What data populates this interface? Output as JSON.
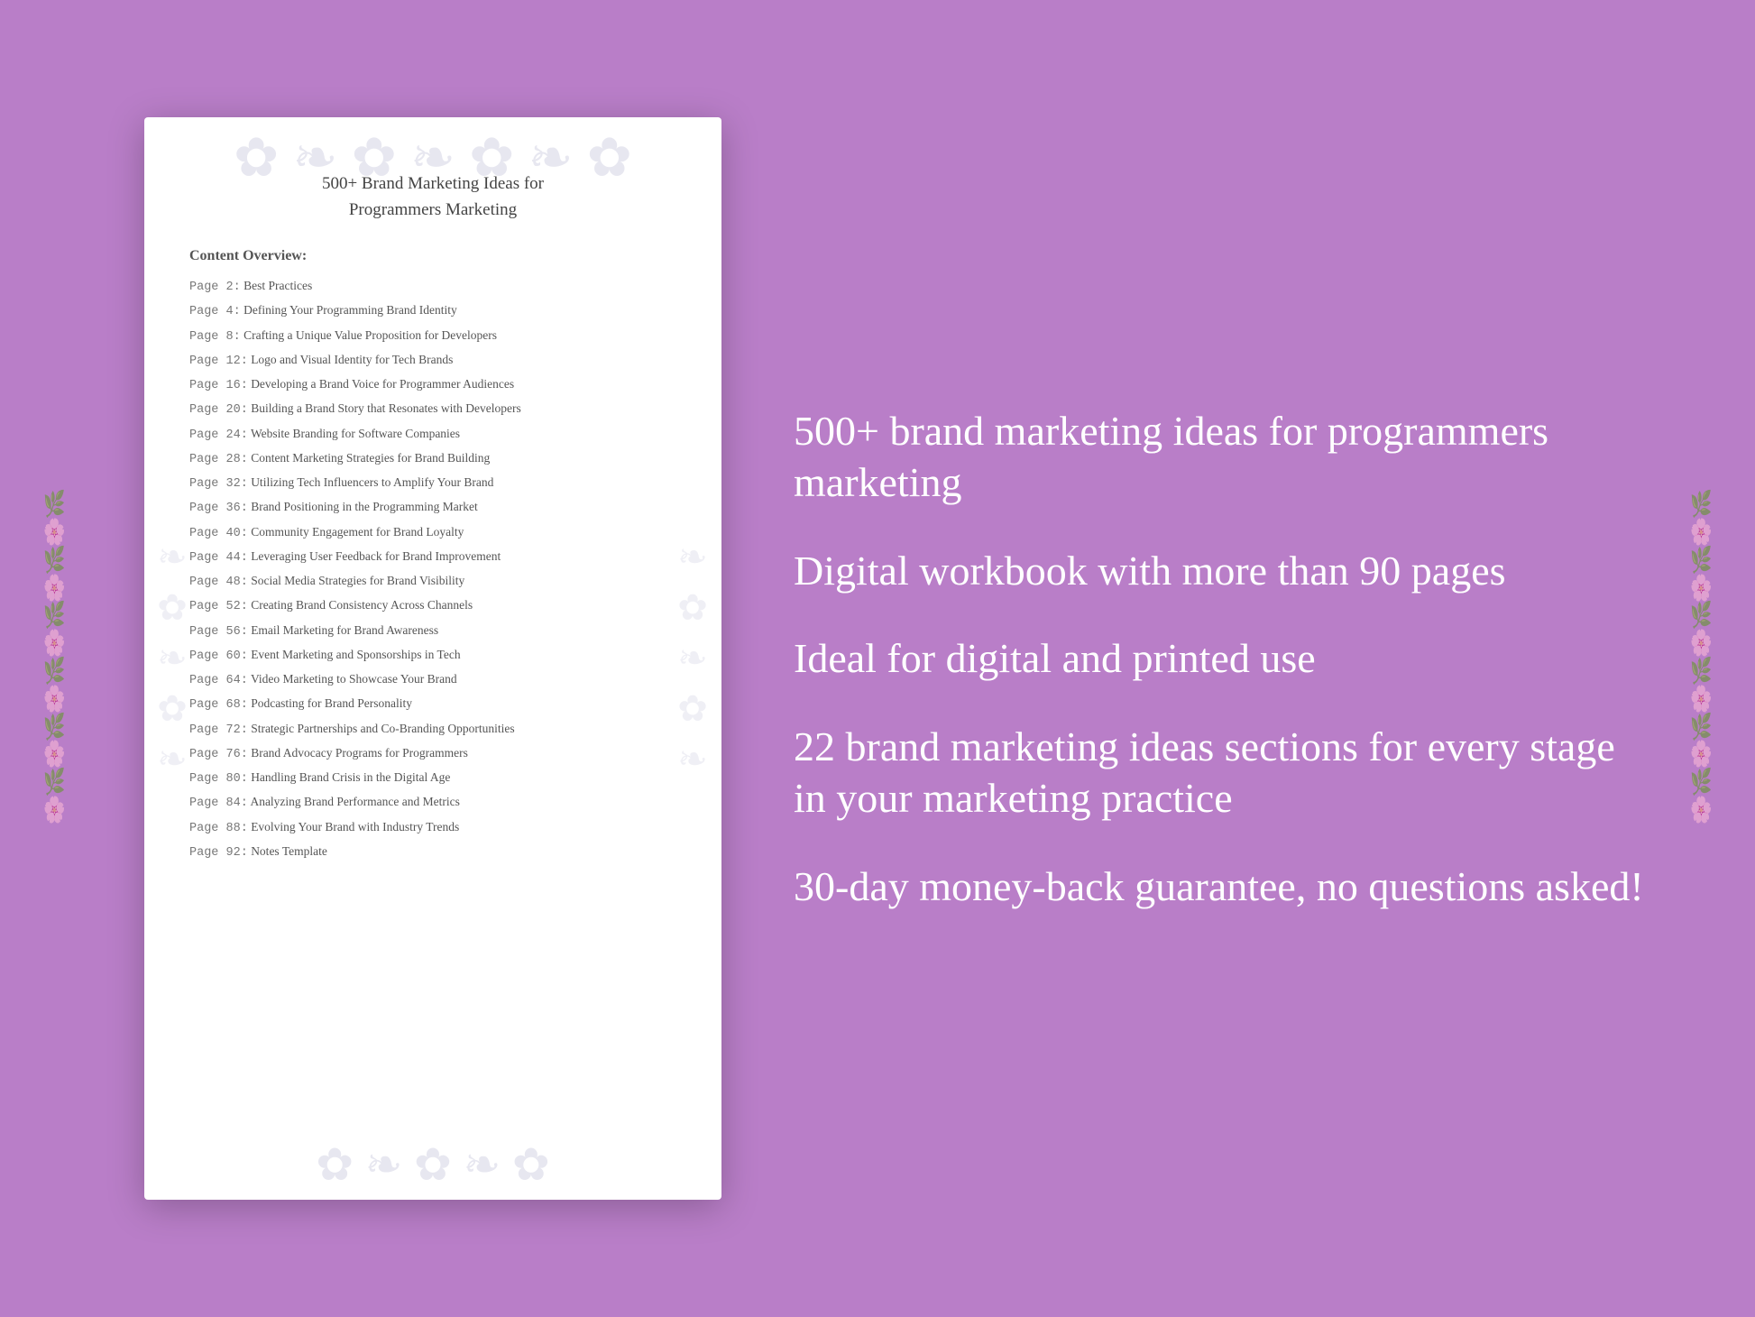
{
  "background_color": "#b97ec8",
  "document": {
    "title_line1": "500+ Brand Marketing Ideas for",
    "title_line2": "Programmers Marketing",
    "content_label": "Content Overview:",
    "toc_items": [
      {
        "page": "Page  2:",
        "title": "Best Practices"
      },
      {
        "page": "Page  4:",
        "title": "Defining Your Programming Brand Identity"
      },
      {
        "page": "Page  8:",
        "title": "Crafting a Unique Value Proposition for Developers"
      },
      {
        "page": "Page 12:",
        "title": "Logo and Visual Identity for Tech Brands"
      },
      {
        "page": "Page 16:",
        "title": "Developing a Brand Voice for Programmer Audiences"
      },
      {
        "page": "Page 20:",
        "title": "Building a Brand Story that Resonates with Developers"
      },
      {
        "page": "Page 24:",
        "title": "Website Branding for Software Companies"
      },
      {
        "page": "Page 28:",
        "title": "Content Marketing Strategies for Brand Building"
      },
      {
        "page": "Page 32:",
        "title": "Utilizing Tech Influencers to Amplify Your Brand"
      },
      {
        "page": "Page 36:",
        "title": "Brand Positioning in the Programming Market"
      },
      {
        "page": "Page 40:",
        "title": "Community Engagement for Brand Loyalty"
      },
      {
        "page": "Page 44:",
        "title": "Leveraging User Feedback for Brand Improvement"
      },
      {
        "page": "Page 48:",
        "title": "Social Media Strategies for Brand Visibility"
      },
      {
        "page": "Page 52:",
        "title": "Creating Brand Consistency Across Channels"
      },
      {
        "page": "Page 56:",
        "title": "Email Marketing for Brand Awareness"
      },
      {
        "page": "Page 60:",
        "title": "Event Marketing and Sponsorships in Tech"
      },
      {
        "page": "Page 64:",
        "title": "Video Marketing to Showcase Your Brand"
      },
      {
        "page": "Page 68:",
        "title": "Podcasting for Brand Personality"
      },
      {
        "page": "Page 72:",
        "title": "Strategic Partnerships and Co-Branding Opportunities"
      },
      {
        "page": "Page 76:",
        "title": "Brand Advocacy Programs for Programmers"
      },
      {
        "page": "Page 80:",
        "title": "Handling Brand Crisis in the Digital Age"
      },
      {
        "page": "Page 84:",
        "title": "Analyzing Brand Performance and Metrics"
      },
      {
        "page": "Page 88:",
        "title": "Evolving Your Brand with Industry Trends"
      },
      {
        "page": "Page 92:",
        "title": "Notes Template"
      }
    ]
  },
  "features": [
    "500+ brand marketing ideas for programmers marketing",
    "Digital workbook with more than 90 pages",
    "Ideal for digital and printed use",
    "22 brand marketing ideas sections for every stage in your marketing practice",
    "30-day money-back guarantee, no questions asked!"
  ]
}
